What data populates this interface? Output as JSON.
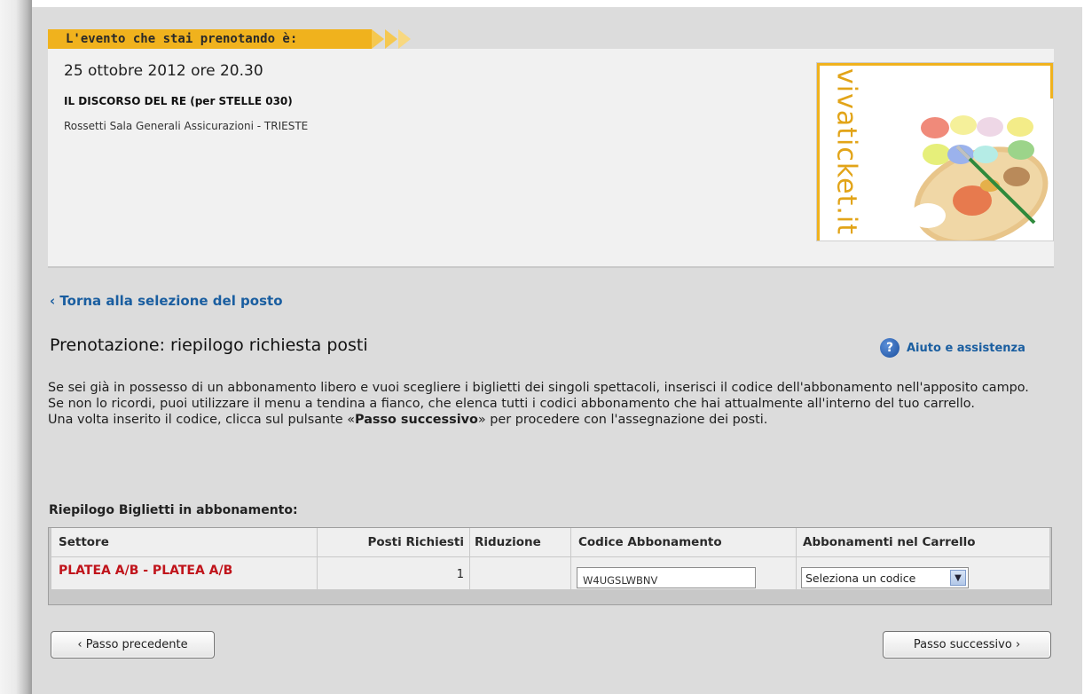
{
  "event": {
    "banner_label": "L'evento che stai prenotando è:",
    "date": "25 ottobre 2012 ore 20.30",
    "title": "IL DISCORSO DEL RE (per STELLE 030)",
    "venue": "Rossetti Sala Generali Assicurazioni - TRIESTE",
    "logo_text": "vivaticket.it"
  },
  "nav": {
    "back_link": "‹ Torna alla selezione del posto"
  },
  "page": {
    "title": "Prenotazione: riepilogo richiesta posti",
    "help_label": "Aiuto e assistenza",
    "help_icon_glyph": "?"
  },
  "description": {
    "line1": "Se sei già in possesso di un abbonamento libero e vuoi scegliere i biglietti dei singoli spettacoli, inserisci il codice dell'abbonamento nell'apposito campo.",
    "line2": "Se non lo ricordi, puoi utilizzare il menu a tendina a fianco, che elenca tutti i codici abbonamento che hai attualmente all'interno del tuo carrello.",
    "line3_pre": "Una volta inserito il codice, clicca sul pulsante «",
    "line3_bold": "Passo successivo",
    "line3_post": "» per procedere con l'assegnazione dei posti."
  },
  "summary": {
    "section_title": "Riepilogo Biglietti in abbonamento:",
    "columns": [
      "Settore",
      "Posti Richiesti",
      "Riduzione",
      "Codice Abbonamento",
      "Abbonamenti nel Carrello"
    ],
    "rows": [
      {
        "sector": "PLATEA A/B - PLATEA A/B",
        "seats": "1",
        "reduction": "",
        "code_value": "W4UGSLWBNV",
        "cart_select": "Seleziona un codice"
      }
    ]
  },
  "buttons": {
    "prev": "‹ Passo precedente",
    "next": "Passo successivo ›"
  },
  "colors": {
    "accent": "#f0b21d",
    "link": "#1a5ea0",
    "sector_red": "#c0141b"
  }
}
